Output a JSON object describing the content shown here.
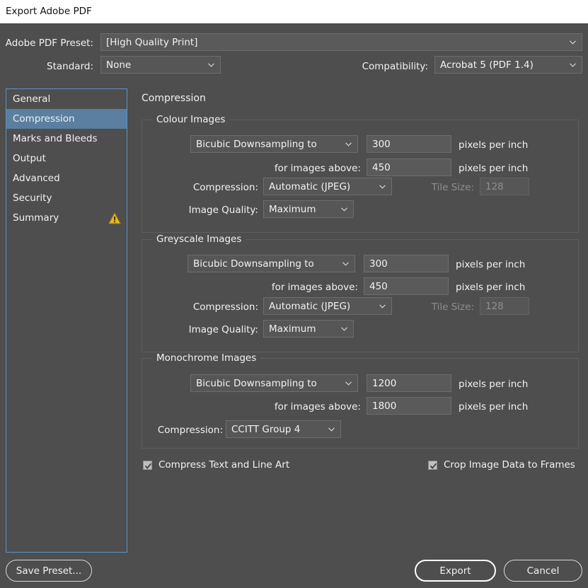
{
  "window": {
    "title": "Export Adobe PDF"
  },
  "top": {
    "preset_label": "Adobe PDF Preset:",
    "preset_value": "[High Quality Print]",
    "standard_label": "Standard:",
    "standard_value": "None",
    "compatibility_label": "Compatibility:",
    "compatibility_value": "Acrobat 5 (PDF 1.4)"
  },
  "sidebar": {
    "items": [
      {
        "label": "General",
        "selected": false,
        "warning": false
      },
      {
        "label": "Compression",
        "selected": true,
        "warning": false
      },
      {
        "label": "Marks and Bleeds",
        "selected": false,
        "warning": false
      },
      {
        "label": "Output",
        "selected": false,
        "warning": false
      },
      {
        "label": "Advanced",
        "selected": false,
        "warning": false
      },
      {
        "label": "Security",
        "selected": false,
        "warning": false
      },
      {
        "label": "Summary",
        "selected": false,
        "warning": true
      }
    ]
  },
  "panel": {
    "title": "Compression",
    "colour": {
      "legend": "Colour Images",
      "downsample_value": "Bicubic Downsampling to",
      "ppi_value": "300",
      "ppi_unit": "pixels per inch",
      "above_label": "for images above:",
      "above_value": "450",
      "above_unit": "pixels per inch",
      "compression_label": "Compression:",
      "compression_value": "Automatic (JPEG)",
      "tile_label": "Tile Size:",
      "tile_value": "128",
      "quality_label": "Image Quality:",
      "quality_value": "Maximum"
    },
    "greyscale": {
      "legend": "Greyscale Images",
      "downsample_value": "Bicubic Downsampling to",
      "ppi_value": "300",
      "ppi_unit": "pixels per inch",
      "above_label": "for images above:",
      "above_value": "450",
      "above_unit": "pixels per inch",
      "compression_label": "Compression:",
      "compression_value": "Automatic (JPEG)",
      "tile_label": "Tile Size:",
      "tile_value": "128",
      "quality_label": "Image Quality:",
      "quality_value": "Maximum"
    },
    "monochrome": {
      "legend": "Monochrome Images",
      "downsample_value": "Bicubic Downsampling to",
      "ppi_value": "1200",
      "ppi_unit": "pixels per inch",
      "above_label": "for images above:",
      "above_value": "1800",
      "above_unit": "pixels per inch",
      "compression_label": "Compression:",
      "compression_value": "CCITT Group 4"
    },
    "compress_text_label": "Compress Text and Line Art",
    "compress_text_checked": true,
    "crop_image_label": "Crop Image Data to Frames",
    "crop_image_checked": true
  },
  "footer": {
    "save_preset": "Save Preset...",
    "export": "Export",
    "cancel": "Cancel"
  },
  "colors": {
    "dialog_bg": "#4e4e4e",
    "titlebar_bg": "#ffffff",
    "selection": "#5a7fa0",
    "focus_border": "#5d92c4",
    "warning": "#e8b521"
  }
}
